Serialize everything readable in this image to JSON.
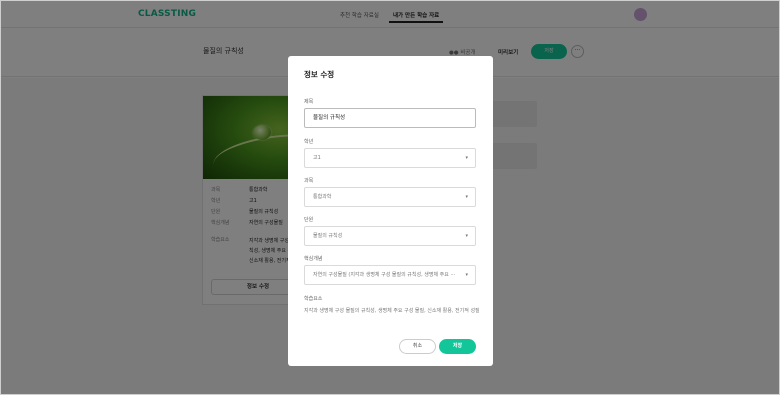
{
  "app": {
    "logo": "CLASSTING",
    "tabs": [
      "추천 학습 자료실",
      "내가 만든 학습 자료"
    ],
    "active_tab_index": 1
  },
  "page": {
    "title": "물질의 규칙성",
    "share_label": "비공개",
    "preview_label": "미리보기",
    "save_label": "저장",
    "more_label": "···"
  },
  "card": {
    "meta": [
      {
        "key": "과목",
        "value": "통합과학"
      },
      {
        "key": "학년",
        "value": "고1"
      },
      {
        "key": "단원",
        "value": "물질의 규칙성"
      },
      {
        "key": "핵심개념",
        "value": "자연의 구성물질"
      }
    ],
    "elements_key": "학습요소",
    "elements_value": "지각과 생명체 구성 물질의 규칙성, 생명체 주요 구성 물질, 신소재 활용, 전기적 성질",
    "edit_button": "정보 수정"
  },
  "modal": {
    "title": "정보 수정",
    "fields": {
      "title": {
        "label": "제목",
        "value": "물질의 규칙성"
      },
      "grade": {
        "label": "학년",
        "value": "고1"
      },
      "subject": {
        "label": "과목",
        "value": "통합과학"
      },
      "unit": {
        "label": "단원",
        "value": "물질의 규칙성"
      },
      "concept": {
        "label": "핵심개념",
        "value": "자연의 구성물질 (지각과 생명체 구성 물질의 규칙성, 생명체 주요 ···"
      }
    },
    "elements_label": "학습요소",
    "elements_text": "지각과 생명체 구성 물질의 규칙성, 생명체 주요 구성 물질, 신소재 활용, 전기적 성질",
    "cancel_label": "취소",
    "save_label": "저장"
  },
  "colors": {
    "brand": "#13b58b",
    "primary_button": "#13c69a"
  },
  "icons": {
    "chevron": "chevron-down-icon",
    "lock": "lock-icon"
  }
}
